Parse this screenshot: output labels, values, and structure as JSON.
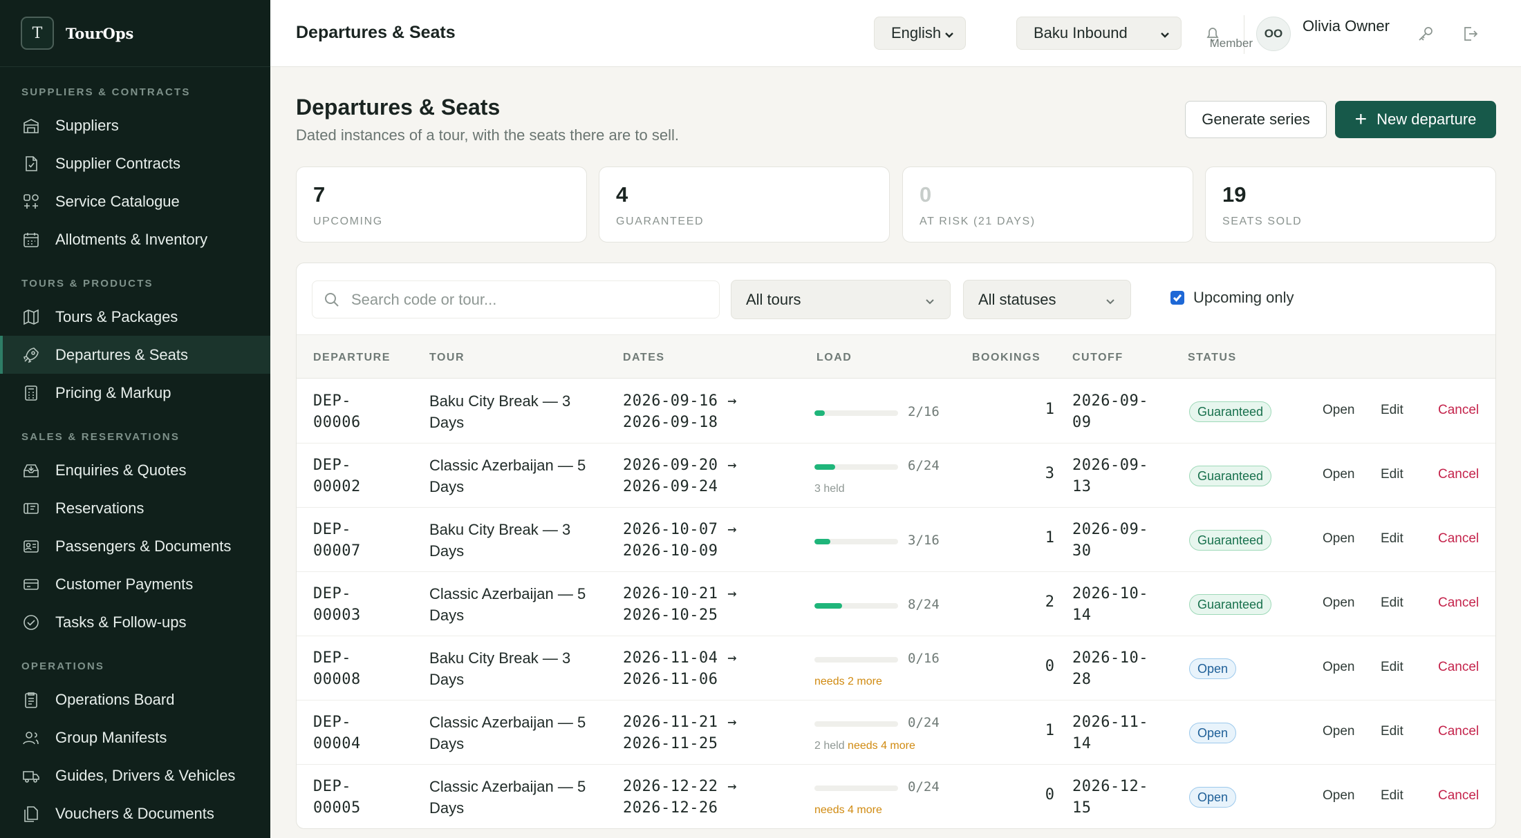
{
  "app": {
    "logo_letter": "T",
    "name": "TourOps"
  },
  "sidebar": {
    "sections": [
      {
        "title": "SUPPLIERS & CONTRACTS",
        "items": [
          "Suppliers",
          "Supplier Contracts",
          "Service Catalogue",
          "Allotments & Inventory"
        ]
      },
      {
        "title": "TOURS & PRODUCTS",
        "items": [
          "Tours & Packages",
          "Departures & Seats",
          "Pricing & Markup"
        ]
      },
      {
        "title": "SALES & RESERVATIONS",
        "items": [
          "Enquiries & Quotes",
          "Reservations",
          "Passengers & Documents",
          "Customer Payments",
          "Tasks & Follow-ups"
        ]
      },
      {
        "title": "OPERATIONS",
        "items": [
          "Operations Board",
          "Group Manifests",
          "Guides, Drivers & Vehicles",
          "Vouchers & Documents"
        ]
      }
    ],
    "active_item": "Departures & Seats"
  },
  "topbar": {
    "title": "Departures & Seats",
    "language": "English",
    "workspace": "Baku Inbound",
    "user_initials": "OO",
    "user_name": "Olivia Owner",
    "user_role": "Member"
  },
  "page": {
    "title": "Departures & Seats",
    "subtitle": "Dated instances of a tour, with the seats there are to sell.",
    "generate_label": "Generate series",
    "new_label": "New departure"
  },
  "stats": [
    {
      "value": "7",
      "label": "UPCOMING"
    },
    {
      "value": "4",
      "label": "GUARANTEED"
    },
    {
      "value": "0",
      "label": "AT RISK (21 DAYS)"
    },
    {
      "value": "19",
      "label": "SEATS SOLD"
    }
  ],
  "filters": {
    "search_placeholder": "Search code or tour...",
    "tour_filter": "All tours",
    "status_filter": "All statuses",
    "upcoming_only_label": "Upcoming only",
    "upcoming_only": true
  },
  "table": {
    "headers": [
      "DEPARTURE",
      "TOUR",
      "DATES",
      "LOAD",
      "BOOKINGS",
      "CUTOFF",
      "STATUS"
    ],
    "actions": {
      "open": "Open",
      "edit": "Edit",
      "cancel": "Cancel"
    },
    "rows": [
      {
        "code_a": "DEP-",
        "code_b": "00006",
        "tour": "Baku City Break — 3 Days",
        "date_from": "2026-09-16 →",
        "date_to": "2026-09-18",
        "load": "2/16",
        "fill": 0.125,
        "held": "",
        "needs": "",
        "bookings": "1",
        "cutoff_a": "2026-09-",
        "cutoff_b": "09",
        "status": "Guaranteed",
        "status_kind": "guaranteed"
      },
      {
        "code_a": "DEP-",
        "code_b": "00002",
        "tour": "Classic Azerbaijan — 5 Days",
        "date_from": "2026-09-20 →",
        "date_to": "2026-09-24",
        "load": "6/24",
        "fill": 0.25,
        "held": "3 held",
        "needs": "",
        "bookings": "3",
        "cutoff_a": "2026-09-",
        "cutoff_b": "13",
        "status": "Guaranteed",
        "status_kind": "guaranteed"
      },
      {
        "code_a": "DEP-",
        "code_b": "00007",
        "tour": "Baku City Break — 3 Days",
        "date_from": "2026-10-07 →",
        "date_to": "2026-10-09",
        "load": "3/16",
        "fill": 0.1875,
        "held": "",
        "needs": "",
        "bookings": "1",
        "cutoff_a": "2026-09-",
        "cutoff_b": "30",
        "status": "Guaranteed",
        "status_kind": "guaranteed"
      },
      {
        "code_a": "DEP-",
        "code_b": "00003",
        "tour": "Classic Azerbaijan — 5 Days",
        "date_from": "2026-10-21 →",
        "date_to": "2026-10-25",
        "load": "8/24",
        "fill": 0.333,
        "held": "",
        "needs": "",
        "bookings": "2",
        "cutoff_a": "2026-10-",
        "cutoff_b": "14",
        "status": "Guaranteed",
        "status_kind": "guaranteed"
      },
      {
        "code_a": "DEP-",
        "code_b": "00008",
        "tour": "Baku City Break — 3 Days",
        "date_from": "2026-11-04 →",
        "date_to": "2026-11-06",
        "load": "0/16",
        "fill": 0,
        "held": "",
        "needs": "needs 2 more",
        "bookings": "0",
        "cutoff_a": "2026-10-",
        "cutoff_b": "28",
        "status": "Open",
        "status_kind": "open"
      },
      {
        "code_a": "DEP-",
        "code_b": "00004",
        "tour": "Classic Azerbaijan — 5 Days",
        "date_from": "2026-11-21 →",
        "date_to": "2026-11-25",
        "load": "0/24",
        "fill": 0,
        "held": "2 held",
        "needs": "needs 4 more",
        "bookings": "1",
        "cutoff_a": "2026-11-",
        "cutoff_b": "14",
        "status": "Open",
        "status_kind": "open"
      },
      {
        "code_a": "DEP-",
        "code_b": "00005",
        "tour": "Classic Azerbaijan — 5 Days",
        "date_from": "2026-12-22 →",
        "date_to": "2026-12-26",
        "load": "0/24",
        "fill": 0,
        "held": "",
        "needs": "needs 4 more",
        "bookings": "0",
        "cutoff_a": "2026-12-",
        "cutoff_b": "15",
        "status": "Open",
        "status_kind": "open"
      }
    ]
  },
  "colors": {
    "sidebar_bg": "#10201b",
    "primary": "#17594a",
    "load_fill": "#1fb57a",
    "cancel": "#c4234b",
    "needs": "#d08a10"
  }
}
